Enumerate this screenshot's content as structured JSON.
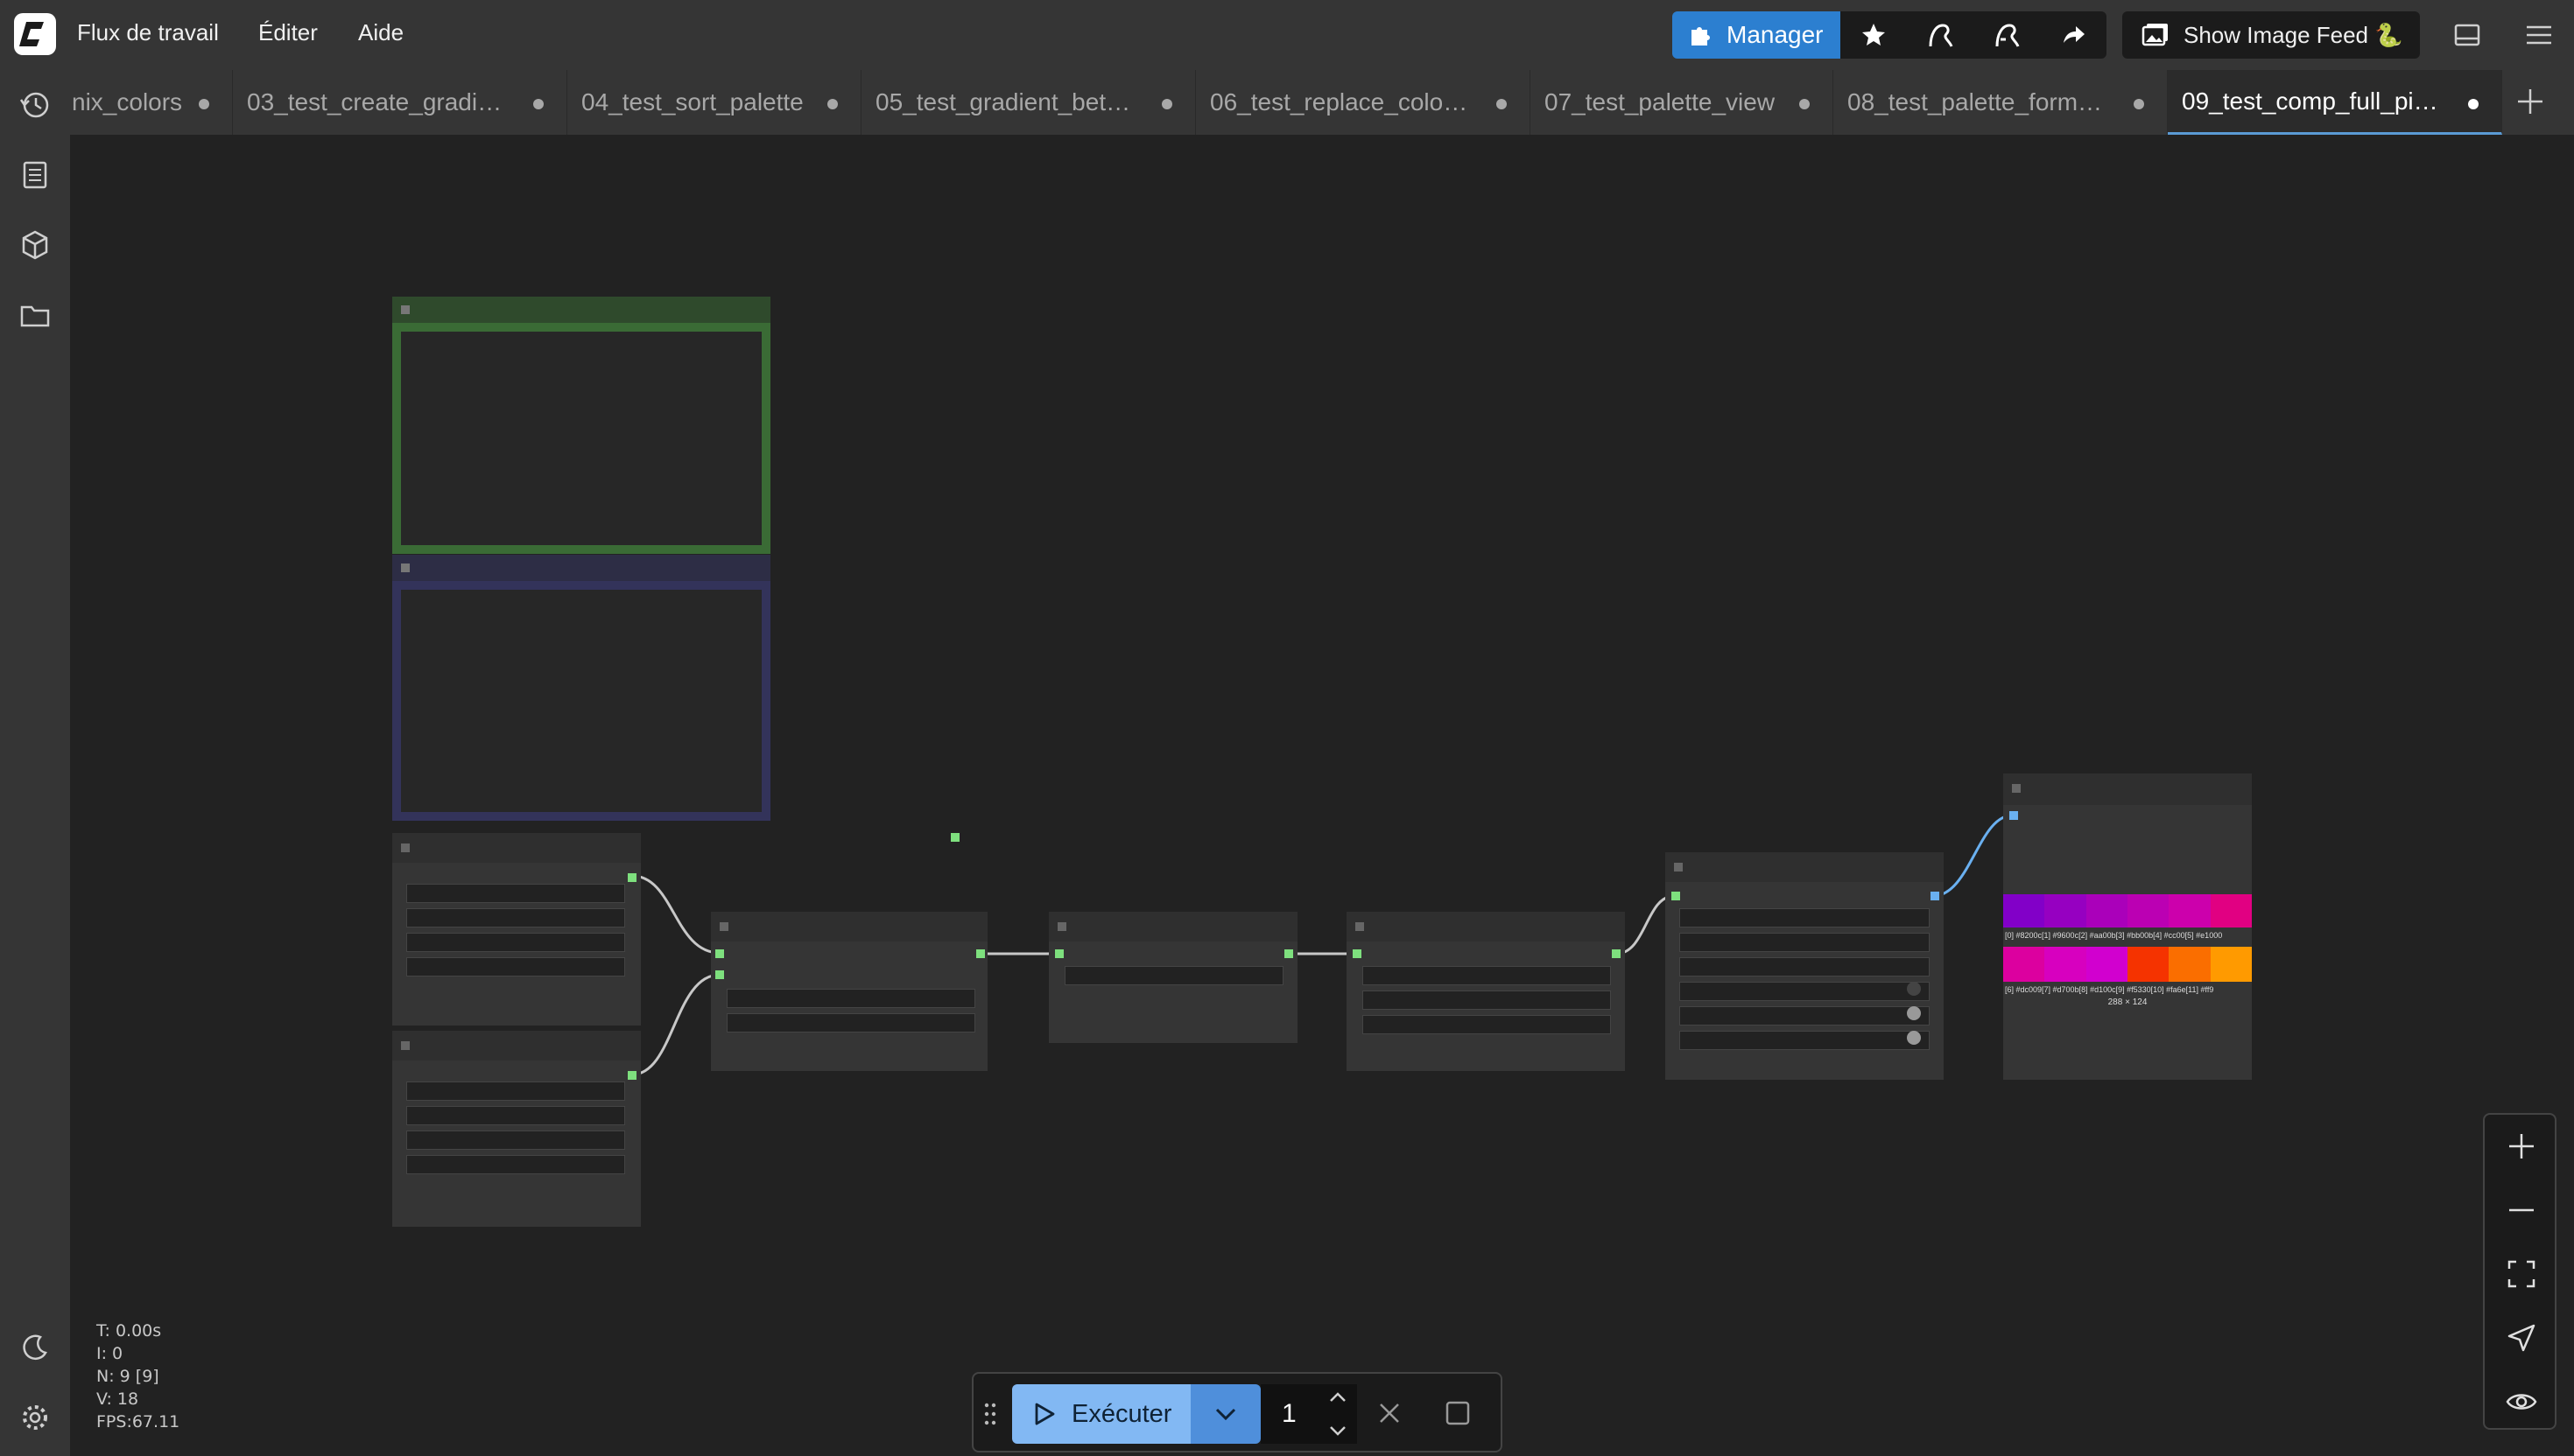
{
  "menu": {
    "workflow": "Flux de travail",
    "edit": "Éditer",
    "help": "Aide"
  },
  "toolbar": {
    "manager_label": "Manager",
    "image_feed_label": "Show Image Feed 🐍"
  },
  "tabs": [
    {
      "label": "nix_colors"
    },
    {
      "label": "03_test_create_gradi…"
    },
    {
      "label": "04_test_sort_palette"
    },
    {
      "label": "05_test_gradient_bet…"
    },
    {
      "label": "06_test_replace_colo…"
    },
    {
      "label": "07_test_palette_view"
    },
    {
      "label": "08_test_palette_form…"
    },
    {
      "label": "09_test_comp_full_pi…",
      "active": true
    }
  ],
  "palette_preview": {
    "row1": [
      "#8200c8",
      "#9600c1",
      "#aa00ba",
      "#bb00b3",
      "#cc00ac",
      "#e10082"
    ],
    "row2": [
      "#dc009f",
      "#d700bf",
      "#d100cf",
      "#f53300",
      "#fa6e00",
      "#ff9a00"
    ],
    "row1_labels": "[0] #8200c[1] #9600c[2] #aa00b[3] #bb00b[4] #cc00[5] #e1000",
    "row2_labels": "[6] #dc009[7] #d700b[8] #d100c[9] #f5330[10] #fa6e[11] #ff9",
    "size_label": "288 × 124"
  },
  "stats": {
    "t": "T: 0.00s",
    "i": "I: 0",
    "n": "N: 9 [9]",
    "v": "V: 18",
    "fps": "FPS:67.11"
  },
  "run": {
    "label": "Exécuter",
    "count": "1"
  },
  "colors": {
    "accent": "#2c7fd0",
    "run_button": "#82b8f3",
    "group_green": "#3a6b35",
    "group_blue": "#33335a",
    "port_green": "#7ee07e",
    "port_blue": "#6ab0f0"
  }
}
